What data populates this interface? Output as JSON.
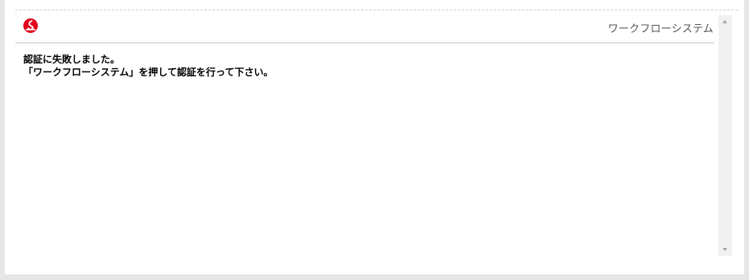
{
  "header": {
    "logo_icon": "red-circle-logo-icon",
    "app_title": "ワークフローシステム"
  },
  "message": {
    "line1": "認証に失敗しました。",
    "line2": "「ワークフローシステム」を押して認証を行って下さい。"
  },
  "colors": {
    "brand_red": "#e2001a",
    "divider": "#c6c6c6"
  },
  "scrollbar": {
    "up_icon": "scroll-up-arrow-icon",
    "down_icon": "scroll-down-arrow-icon"
  }
}
